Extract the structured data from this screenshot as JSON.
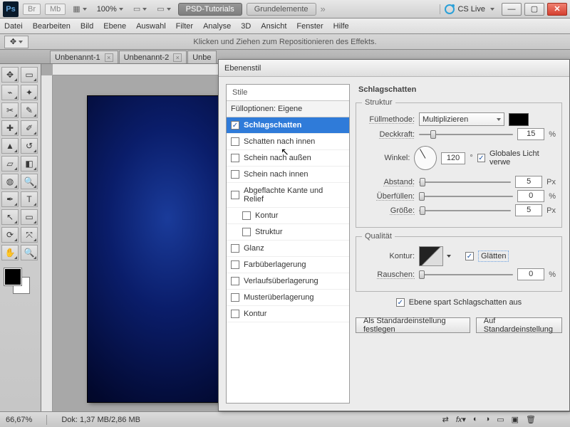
{
  "topbar": {
    "logo": "Ps",
    "chips": [
      "Br",
      "Mb"
    ],
    "zoom": "100%",
    "btn_tut": "PSD-Tutorials",
    "btn_grund": "Grundelemente",
    "cslive": "CS Live"
  },
  "menu": [
    "Datei",
    "Bearbeiten",
    "Bild",
    "Ebene",
    "Auswahl",
    "Filter",
    "Analyse",
    "3D",
    "Ansicht",
    "Fenster",
    "Hilfe"
  ],
  "optbar_hint": "Klicken und Ziehen zum Repositionieren des Effekts.",
  "tabs": [
    "Unbenannt-1",
    "Unbenannt-2",
    "Unbe"
  ],
  "status": {
    "zoom": "66,67%",
    "doc": "Dok: 1,37 MB/2,86 MB"
  },
  "dialog": {
    "title": "Ebenenstil",
    "styles_header": "Stile",
    "items": {
      "fill": "Füllopt­ionen: Eigene",
      "ds": "Schlagschatten",
      "is": "Schatten nach innen",
      "og": "Schein nach außen",
      "ig": "Schein nach innen",
      "bevel": "Abgeflachte Kante und Relief",
      "kont": "Kontur",
      "strukt": "Struktur",
      "glanz": "Glanz",
      "farb": "Farbüberlagerung",
      "verl": "Verlaufsüberlagerung",
      "must": "Musterüberlagerung",
      "kont2": "Kontur"
    },
    "right": {
      "title": "Schlagschatten",
      "struktur_legend": "Struktur",
      "fillmode_label": "Füllmethode:",
      "fillmode_value": "Multiplizieren",
      "opacity_label": "Deckkraft:",
      "opacity_value": "15",
      "opacity_unit": "%",
      "angle_label": "Winkel:",
      "angle_value": "120",
      "angle_unit": "°",
      "global_label": "Globales Licht verwe",
      "dist_label": "Abstand:",
      "dist_value": "5",
      "dist_unit": "Px",
      "spread_label": "Überfüllen:",
      "spread_value": "0",
      "spread_unit": "%",
      "size_label": "Größe:",
      "size_value": "5",
      "size_unit": "Px",
      "qual_legend": "Qualität",
      "kontur_label": "Kontur:",
      "glatten_label": "Glätten",
      "rauschen_label": "Rauschen:",
      "rauschen_value": "0",
      "rauschen_unit": "%",
      "knockout_label": "Ebene spart Schlagschatten aus",
      "btn_default": "Als Standardeinstellung festlegen",
      "btn_reset": "Auf Standardeinstellung"
    }
  }
}
